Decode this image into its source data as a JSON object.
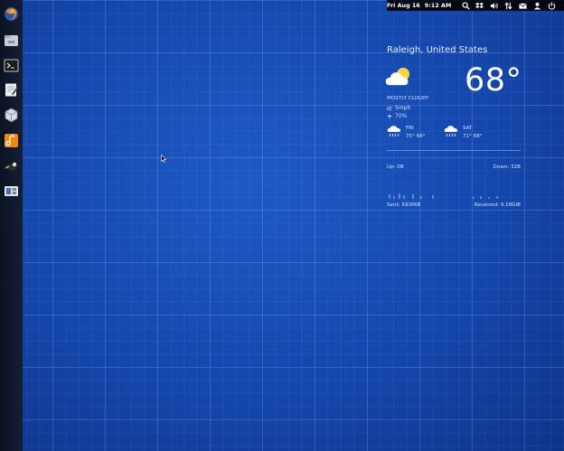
{
  "desktop": {
    "wallpaper": "blueprint-grid"
  },
  "topbar": {
    "date": "Fri Aug 16",
    "time": "9:12 AM",
    "indicators": [
      "search-icon",
      "dropbox-icon",
      "volume-icon",
      "network-icon",
      "mail-icon",
      "user-icon",
      "power-icon"
    ]
  },
  "dock": {
    "launchers": [
      "firefox",
      "files",
      "terminal",
      "text-editor",
      "virtualbox",
      "music",
      "game",
      "system-monitor"
    ]
  },
  "weather": {
    "location": "Raleigh, United States",
    "temperature": "68°",
    "condition": "MOSTLY CLOUDY",
    "wind": "5mph",
    "humidity": "70%",
    "forecast": [
      {
        "day": "FRI",
        "temps": "75° 66°",
        "icon": "rain-cloud-icon"
      },
      {
        "day": "SAT",
        "temps": "71° 68°",
        "icon": "rain-cloud-icon"
      }
    ]
  },
  "network": {
    "up": "Up: 0B",
    "down": "Down: 32B",
    "sent": "Sent: 593MiB",
    "received": "Received: 9.18GiB"
  },
  "colors": {
    "accent": "#1547ad",
    "panel": "#000000",
    "text": "#eaf2ff"
  }
}
